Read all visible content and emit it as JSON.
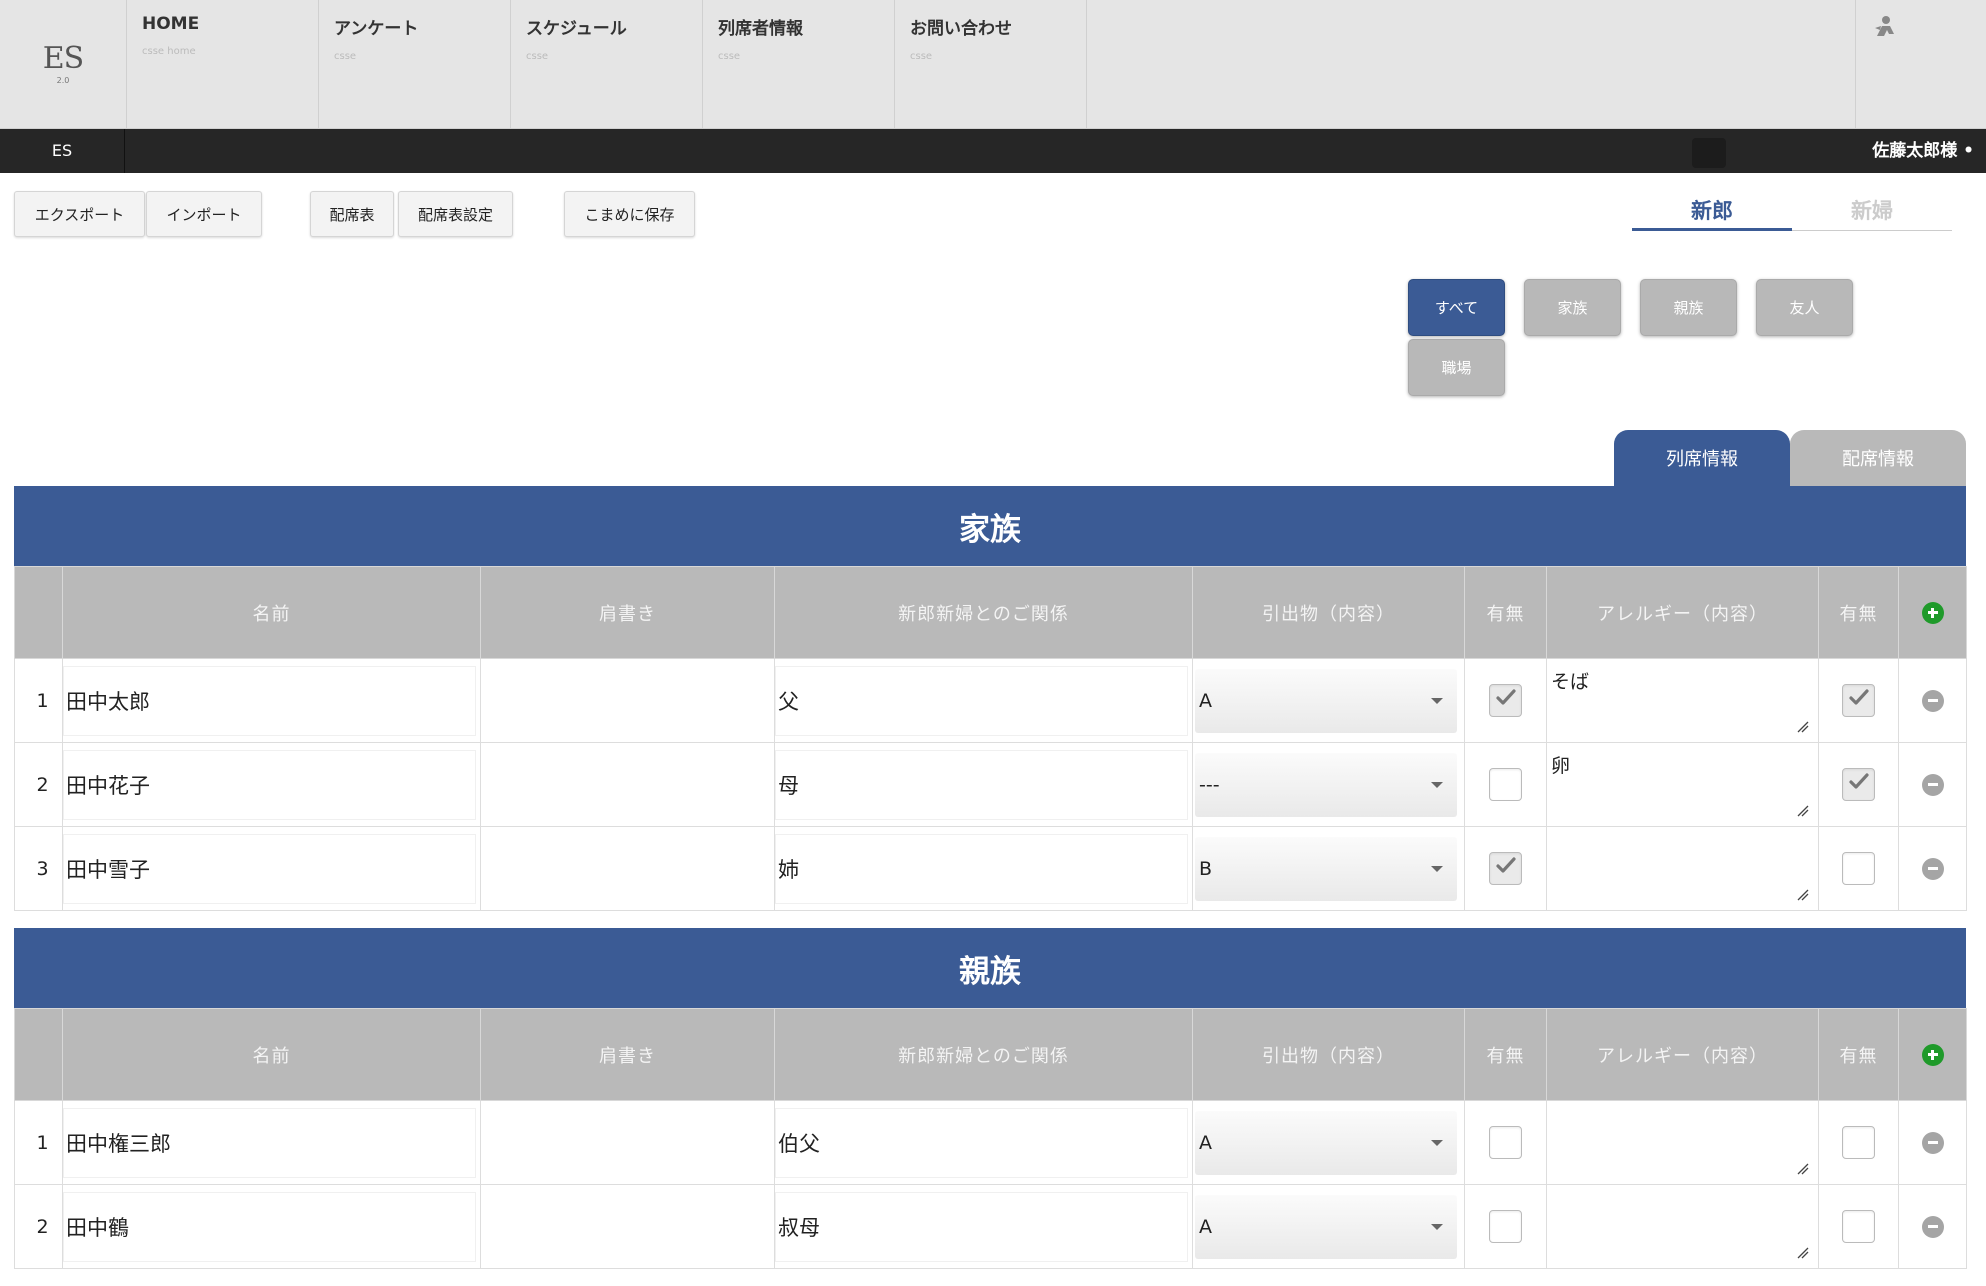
{
  "logo": {
    "text": "ES",
    "version": "2.0"
  },
  "nav": [
    {
      "label": "HOME",
      "sub": "csse home"
    },
    {
      "label": "アンケート",
      "sub": "csse"
    },
    {
      "label": "スケジュール",
      "sub": "csse"
    },
    {
      "label": "列席者情報",
      "sub": "csse"
    },
    {
      "label": "お問い合わせ",
      "sub": "csse"
    }
  ],
  "bar": {
    "left": "ES",
    "user": "佐藤太郎様 •"
  },
  "toolbar": {
    "export": "エクスポート",
    "import": "インポート",
    "seating": "配席表",
    "seating_settings": "配席表設定",
    "autosave": "こまめに保存"
  },
  "side": {
    "groom": "新郎",
    "bride": "新婦"
  },
  "filters": [
    "すべて",
    "家族",
    "親族",
    "友人",
    "職場"
  ],
  "view_tabs": {
    "attendance": "列席情報",
    "seating": "配席情報"
  },
  "columns": [
    "名前",
    "肩書き",
    "新郎新婦とのご関係",
    "引出物（内容）",
    "有無",
    "アレルギー（内容）",
    "有無"
  ],
  "sections": [
    {
      "title": "家族",
      "rows": [
        {
          "no": "1",
          "name": "田中太郎",
          "title": "",
          "relation": "父",
          "gift": "A",
          "gift_check": true,
          "allergy": "そば",
          "allergy_check": true
        },
        {
          "no": "2",
          "name": "田中花子",
          "title": "",
          "relation": "母",
          "gift": "---",
          "gift_check": false,
          "allergy": "卵",
          "allergy_check": true
        },
        {
          "no": "3",
          "name": "田中雪子",
          "title": "",
          "relation": "姉",
          "gift": "B",
          "gift_check": true,
          "allergy": "",
          "allergy_check": false
        }
      ]
    },
    {
      "title": "親族",
      "rows": [
        {
          "no": "1",
          "name": "田中権三郎",
          "title": "",
          "relation": "伯父",
          "gift": "A",
          "gift_check": false,
          "allergy": "",
          "allergy_check": false
        },
        {
          "no": "2",
          "name": "田中鶴",
          "title": "",
          "relation": "叔母",
          "gift": "A",
          "gift_check": false,
          "allergy": "",
          "allergy_check": false
        }
      ]
    }
  ]
}
